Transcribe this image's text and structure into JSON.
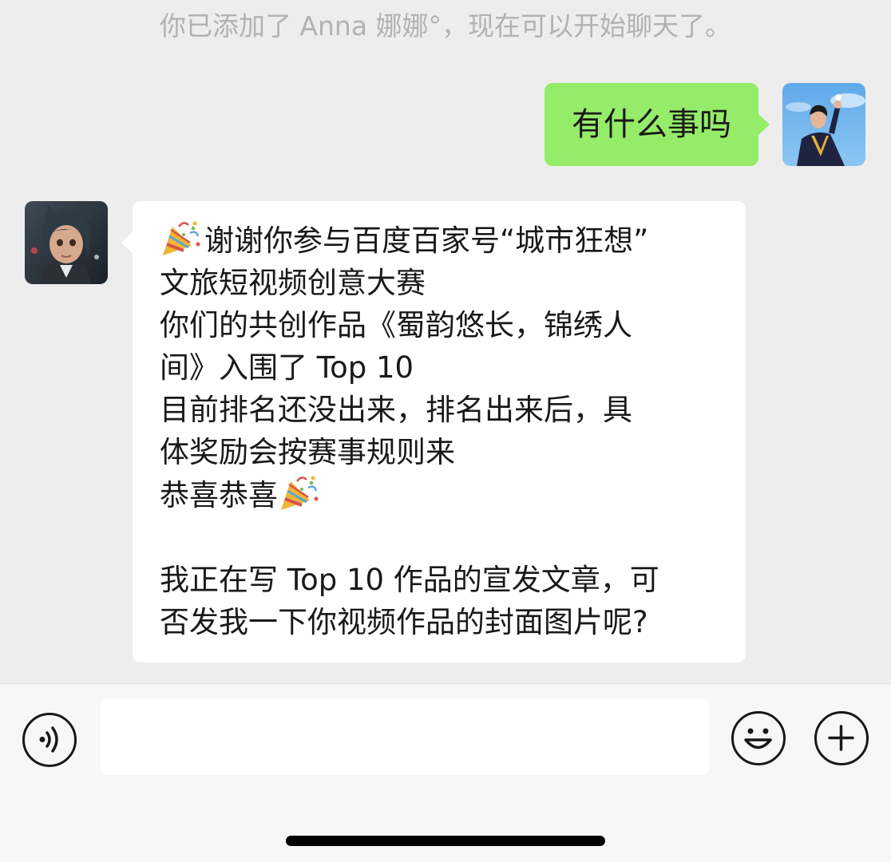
{
  "system_notice": "你已添加了 Anna 娜娜°，现在可以开始聊天了。",
  "messages": {
    "outgoing": {
      "text": "有什么事吗",
      "bubble_color": "#95ec69",
      "avatar_icon": "graduate-photo-avatar"
    },
    "incoming": {
      "bubble_color": "#ffffff",
      "avatar_icon": "cartoon-girl-avatar",
      "emoji_icon": "party-popper-icon",
      "lines": [
        "谢谢你参与百度百家号“城市狂想”",
        "文旅短视频创意大赛",
        "你们的共创作品《蜀韵悠长，锦绣人",
        "间》入围了 Top 10",
        "目前排名还没出来，排名出来后，具",
        "体奖励会按赛事规则来",
        "恭喜恭喜",
        "",
        "我正在写 Top 10 作品的宣发文章，可",
        "否发我一下你视频作品的封面图片呢?"
      ]
    }
  },
  "input_bar": {
    "text_value": "",
    "voice_icon": "voice-icon",
    "emoji_icon": "emoji-icon",
    "plus_icon": "plus-icon"
  },
  "colors": {
    "background": "#ededed",
    "notice_text": "#b2b2b2",
    "outgoing_bubble": "#95ec69",
    "incoming_bubble": "#ffffff",
    "input_bar": "#f7f7f7"
  }
}
